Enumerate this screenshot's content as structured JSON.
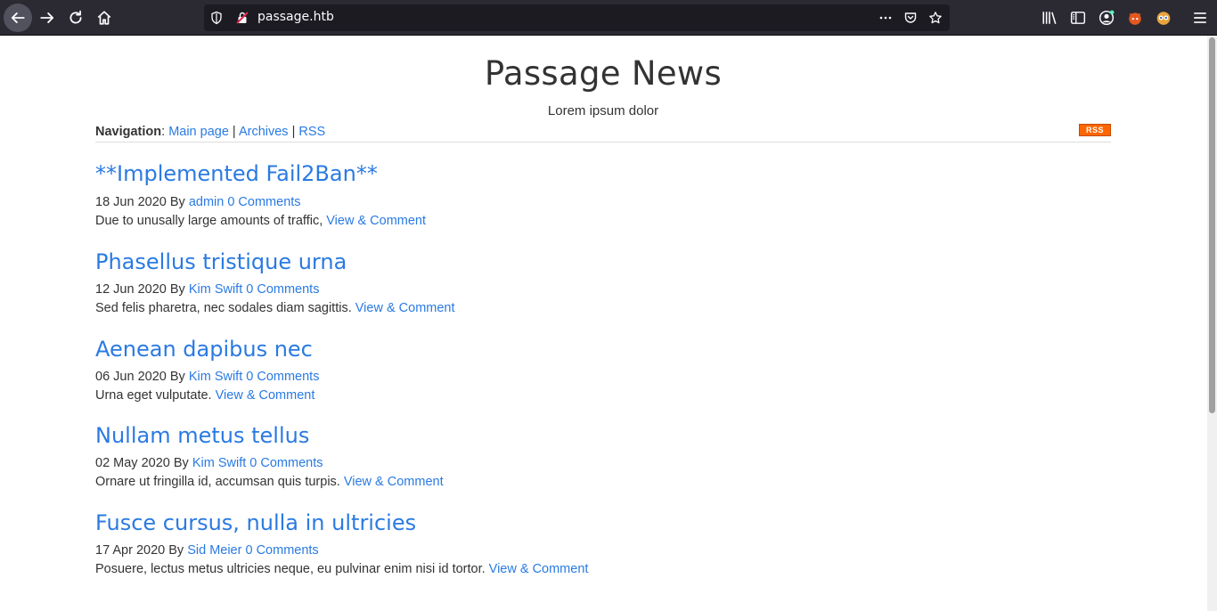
{
  "browser": {
    "url": "passage.htb"
  },
  "site": {
    "title": "Passage News",
    "subtitle": "Lorem ipsum dolor"
  },
  "nav": {
    "label": "Navigation",
    "links": [
      "Main page",
      "Archives",
      "RSS"
    ],
    "rss_badge": "RSS"
  },
  "posts": [
    {
      "title": "**Implemented Fail2Ban**",
      "date": "18 Jun 2020",
      "by": "By",
      "author": "admin",
      "comments": "0 Comments",
      "excerpt": "Due to unusally large amounts of traffic,",
      "link": "View & Comment"
    },
    {
      "title": "Phasellus tristique urna",
      "date": "12 Jun 2020",
      "by": "By",
      "author": "Kim Swift",
      "comments": "0 Comments",
      "excerpt": "Sed felis pharetra, nec sodales diam sagittis.",
      "link": "View & Comment"
    },
    {
      "title": "Aenean dapibus nec",
      "date": "06 Jun 2020",
      "by": "By",
      "author": "Kim Swift",
      "comments": "0 Comments",
      "excerpt": "Urna eget vulputate.",
      "link": "View & Comment"
    },
    {
      "title": "Nullam metus tellus",
      "date": "02 May 2020",
      "by": "By",
      "author": "Kim Swift",
      "comments": "0 Comments",
      "excerpt": "Ornare ut fringilla id, accumsan quis turpis.",
      "link": "View & Comment"
    },
    {
      "title": "Fusce cursus, nulla in ultricies",
      "date": "17 Apr 2020",
      "by": "By",
      "author": "Sid Meier",
      "comments": "0 Comments",
      "excerpt": "Posuere, lectus metus ultricies neque, eu pulvinar enim nisi id tortor.",
      "link": "View & Comment"
    }
  ],
  "colors": {
    "link": "#2a7ae2",
    "toolbar": "#2b2a33",
    "text": "#333333"
  }
}
